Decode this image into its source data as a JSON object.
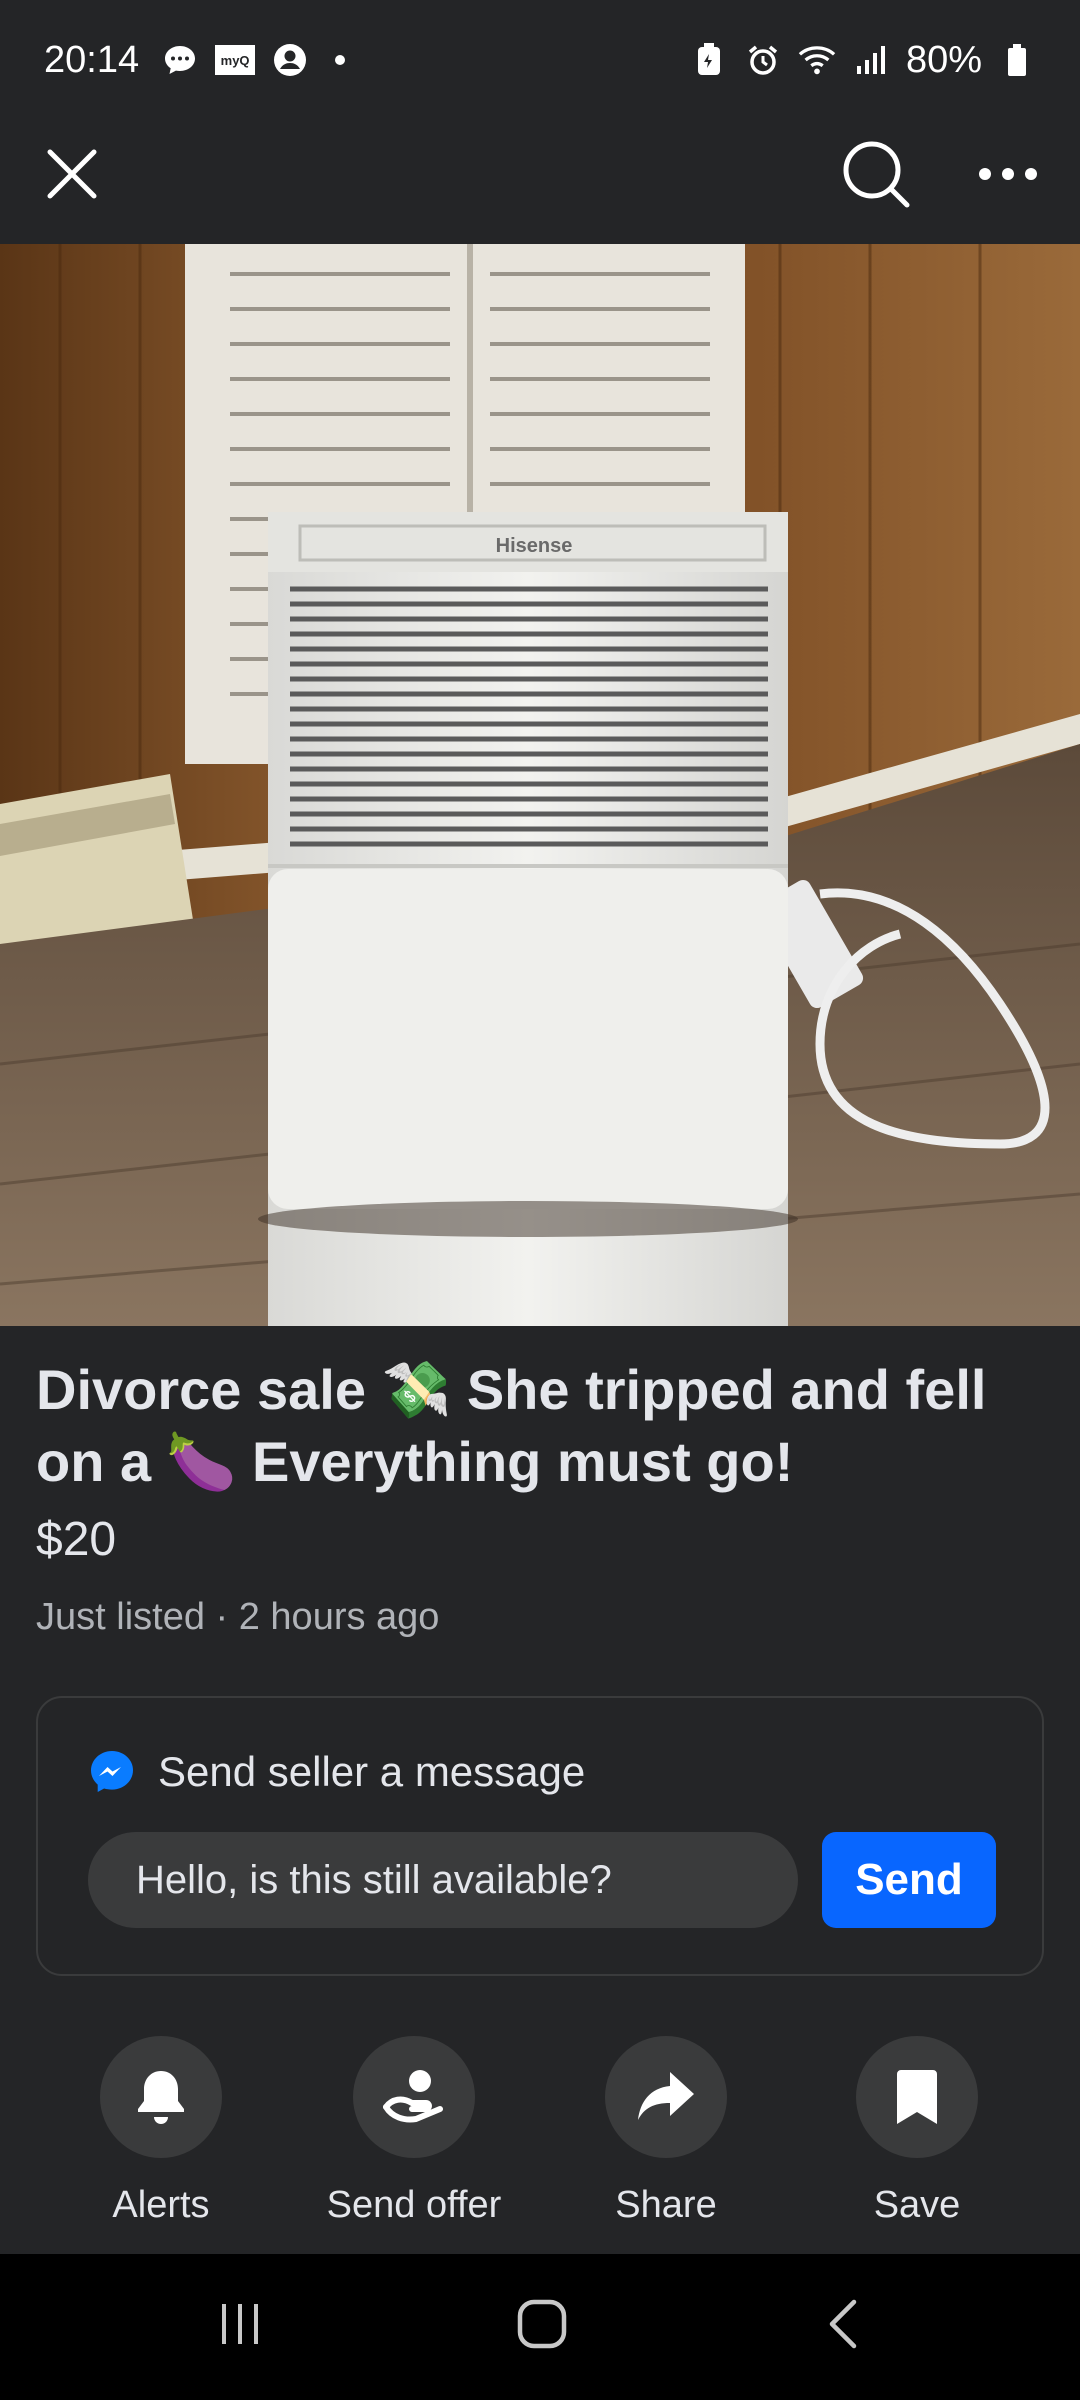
{
  "status_bar": {
    "time": "20:14",
    "battery": "80%",
    "myq_label": "myQ",
    "left_icons": [
      "chat-bubble-icon",
      "myq-icon",
      "account-circle-icon",
      "notification-dot"
    ],
    "right_icons": [
      "battery-saver-icon",
      "alarm-icon",
      "wifi-icon",
      "signal-icon",
      "battery-icon"
    ]
  },
  "app_bar": {
    "icons": [
      "close-icon",
      "search-icon",
      "more-icon"
    ]
  },
  "gallery": {
    "image_count": 2,
    "current_index": 1
  },
  "listing": {
    "title": "Divorce sale 💸 She tripped and fell on a 🍆 Everything must go!",
    "price": "$20",
    "meta": "Just listed · 2 hours ago"
  },
  "message_card": {
    "heading": "Send seller a message",
    "input_value": "Hello, is this still available?",
    "send_label": "Send",
    "accent": "#0866ff"
  },
  "actions": [
    {
      "label": "Alerts",
      "icon": "bell-icon"
    },
    {
      "label": "Send offer",
      "icon": "offer-hand-icon"
    },
    {
      "label": "Share",
      "icon": "share-arrow-icon"
    },
    {
      "label": "Save",
      "icon": "bookmark-icon"
    }
  ],
  "nav_bar": {
    "icons": [
      "recents-icon",
      "home-icon",
      "back-icon"
    ]
  },
  "colors": {
    "background": "#242527",
    "text": "#e4e6eb",
    "secondary_text": "#b0b3b8",
    "surface": "#3a3b3c"
  }
}
